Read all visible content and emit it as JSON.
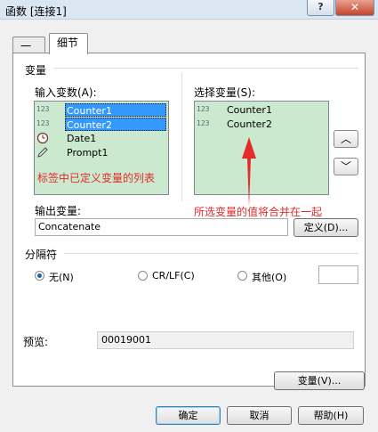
{
  "window": {
    "title": "函数 [连接1]",
    "help_glyph": "?",
    "close_glyph": "✕"
  },
  "tabs": [
    {
      "label": "一般"
    },
    {
      "label": "细节"
    }
  ],
  "variables_group": {
    "label": "变量"
  },
  "input_variables": {
    "label": "输入变数(A):",
    "items": [
      {
        "icon": "123",
        "label": "Counter1",
        "selected": true
      },
      {
        "icon": "123",
        "label": "Counter2",
        "selected": true
      },
      {
        "icon": "clock",
        "label": "Date1",
        "selected": false
      },
      {
        "icon": "pen",
        "label": "Prompt1",
        "selected": false
      }
    ],
    "annotation": "标签中已定义变量的列表"
  },
  "selected_variables": {
    "label": "选择变量(S):",
    "items": [
      {
        "icon": "123",
        "label": "Counter1"
      },
      {
        "icon": "123",
        "label": "Counter2"
      }
    ],
    "annotation": "所选变量的值将合并在一起",
    "move_up_glyph": "︿",
    "move_down_glyph": "﹀"
  },
  "output_variable": {
    "label": "输出变量:",
    "value": "Concatenate",
    "define_button": "定义(D)..."
  },
  "separator_group": {
    "label": "分隔符",
    "options": [
      {
        "label": "无(N)",
        "checked": true
      },
      {
        "label": "CR/LF(C)",
        "checked": false
      },
      {
        "label": "其他(O)",
        "checked": false
      }
    ],
    "other_value": ""
  },
  "preview": {
    "label": "预览:",
    "value": "00019001"
  },
  "variables_button": "变量(V)...",
  "footer": {
    "ok": "确定",
    "cancel": "取消",
    "help": "帮助(H)"
  },
  "colors": {
    "annotation": "#e32b2b",
    "listbox_bg": "#cae9cf",
    "selection": "#3399ff"
  }
}
